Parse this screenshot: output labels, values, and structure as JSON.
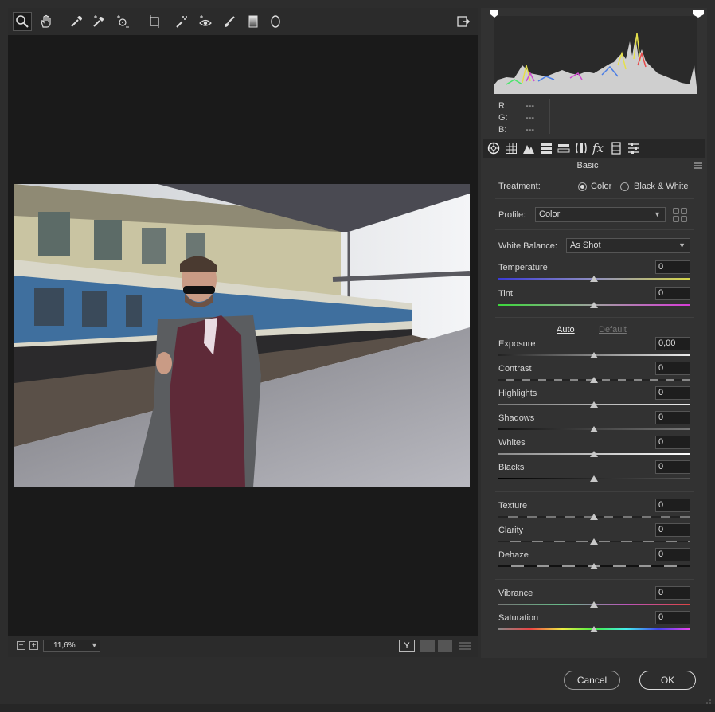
{
  "toolbar": {
    "tools": [
      "zoom-tool-icon",
      "hand-tool-icon",
      "white-balance-tool-icon",
      "color-sampler-tool-icon",
      "targeted-adjustment-tool-icon",
      "crop-tool-icon",
      "spot-removal-tool-icon",
      "red-eye-tool-icon",
      "adjustment-brush-icon",
      "graduated-filter-icon",
      "radial-filter-icon"
    ],
    "open_button_icon": "open-preferences-icon"
  },
  "histogram": {
    "r_label": "R:",
    "g_label": "G:",
    "b_label": "B:",
    "r_value": "---",
    "g_value": "---",
    "b_value": "---"
  },
  "panel": {
    "title": "Basic"
  },
  "treatment": {
    "label": "Treatment:",
    "color": "Color",
    "bw": "Black & White",
    "selected": "Color"
  },
  "profile": {
    "label": "Profile:",
    "value": "Color"
  },
  "white_balance": {
    "label": "White Balance:",
    "value": "As Shot"
  },
  "auto_label": "Auto",
  "default_label": "Default",
  "sliders": [
    {
      "label": "Temperature",
      "value": "0"
    },
    {
      "label": "Tint",
      "value": "0"
    },
    {
      "label": "Exposure",
      "value": "0,00"
    },
    {
      "label": "Contrast",
      "value": "0"
    },
    {
      "label": "Highlights",
      "value": "0"
    },
    {
      "label": "Shadows",
      "value": "0"
    },
    {
      "label": "Whites",
      "value": "0"
    },
    {
      "label": "Blacks",
      "value": "0"
    },
    {
      "label": "Texture",
      "value": "0"
    },
    {
      "label": "Clarity",
      "value": "0"
    },
    {
      "label": "Dehaze",
      "value": "0"
    },
    {
      "label": "Vibrance",
      "value": "0"
    },
    {
      "label": "Saturation",
      "value": "0"
    }
  ],
  "status": {
    "zoom": "11,6%"
  },
  "footer": {
    "cancel": "Cancel",
    "ok": "OK"
  }
}
